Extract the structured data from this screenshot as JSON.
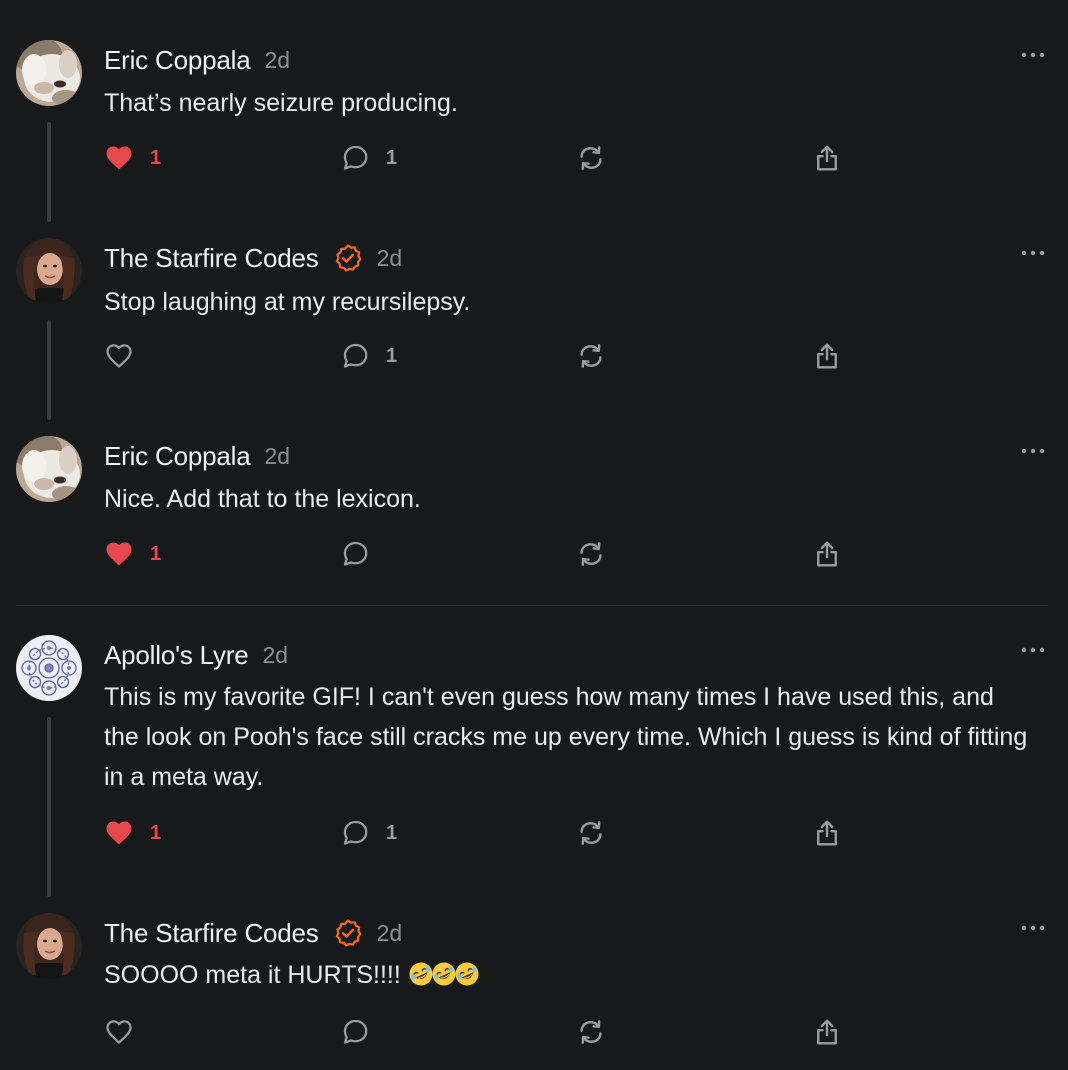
{
  "colors": {
    "background": "#18191b",
    "like_active": "#e5484d",
    "verified_badge": "#ff6719",
    "muted": "#8e8f94"
  },
  "posts": [
    {
      "author": "Eric Coppala",
      "time": "2d",
      "verified": false,
      "avatar": "dog-photo",
      "text": "That’s nearly seizure producing.",
      "liked": true,
      "likes": "1",
      "replies": "1"
    },
    {
      "author": "The Starfire Codes",
      "time": "2d",
      "verified": true,
      "avatar": "woman-photo",
      "text": "Stop laughing at my recursilepsy.",
      "liked": false,
      "likes": "",
      "replies": "1"
    },
    {
      "author": "Eric Coppala",
      "time": "2d",
      "verified": false,
      "avatar": "dog-photo",
      "text": "Nice. Add that to the lexicon.",
      "liked": true,
      "likes": "1",
      "replies": ""
    },
    {
      "author": "Apollo's Lyre",
      "time": "2d",
      "verified": false,
      "avatar": "fractal-pattern",
      "text": "This is my favorite GIF! I can't even guess how many times I have used this, and the look on Pooh's face still cracks me up every time. Which I guess is kind of fitting in a meta way.",
      "liked": true,
      "likes": "1",
      "replies": "1"
    },
    {
      "author": "The Starfire Codes",
      "time": "2d",
      "verified": true,
      "avatar": "woman-photo",
      "text": "SOOOO meta it HURTS!!!! ",
      "emoji": [
        "rolling-on-floor-laughing-emoji",
        "rolling-on-floor-laughing-emoji",
        "rolling-on-floor-laughing-emoji"
      ],
      "liked": false,
      "likes": "",
      "replies": ""
    }
  ]
}
